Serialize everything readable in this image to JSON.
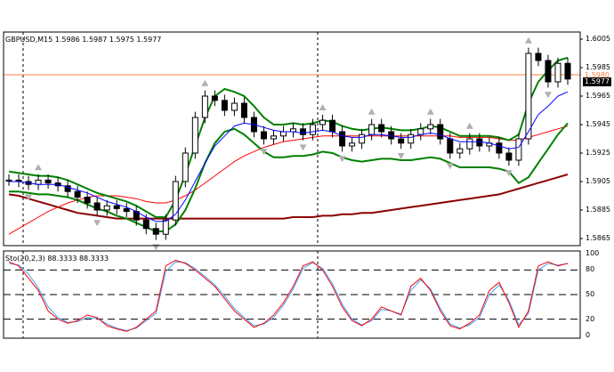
{
  "main_panel": {
    "title": "GBPUSD,M15  1.5986 1.5987 1.5975 1.5977",
    "price_labels": [
      "1.6005",
      "1.5985",
      "1.5965",
      "1.5945",
      "1.5925",
      "1.5905",
      "1.5885",
      "1.5865"
    ],
    "current_price": "1.5977",
    "upper_tag": "1.5980",
    "colors": {
      "ma_fast": "#0000ff",
      "ma_mid": "#ff0000",
      "ma_slow": "#8b0000",
      "envelope": "#008000",
      "candles": "#000000",
      "fractals": "#b0b0b0",
      "hline": "#ff8040",
      "price_tag_bg": "#000000"
    }
  },
  "sub_panel": {
    "title": "Sto(20,2,3) 88.3333 88.3333",
    "level_labels": [
      "100",
      "80",
      "50",
      "20",
      "0"
    ],
    "colors": {
      "main": "#ff0000",
      "signal": "#40a0ff"
    }
  },
  "chart_data": {
    "type": "line",
    "title": "GBPUSD,M15  1.5986 1.5987 1.5975 1.5977",
    "ylim": [
      1.586,
      1.601
    ],
    "y_ticks": [
      1.6005,
      1.5985,
      1.5965,
      1.5945,
      1.5925,
      1.5905,
      1.5885,
      1.5865
    ],
    "grid": false,
    "series": [
      {
        "values": [
          1.5906,
          1.5905,
          1.5903,
          1.5906,
          1.5904,
          1.5902,
          1.5898,
          1.5894,
          1.589,
          1.5885,
          1.5888,
          1.5886,
          1.5884,
          1.5878,
          1.5872,
          1.5868,
          1.5878,
          1.5905,
          1.5925,
          1.595,
          1.5965,
          1.5962,
          1.5955,
          1.596,
          1.595,
          1.594,
          1.5935,
          1.5937,
          1.594,
          1.5942,
          1.5938,
          1.5945,
          1.5948,
          1.594,
          1.593,
          1.5932,
          1.5938,
          1.5945,
          1.594,
          1.5935,
          1.5932,
          1.5938,
          1.5942,
          1.5945,
          1.5935,
          1.5925,
          1.5928,
          1.5935,
          1.593,
          1.5932,
          1.5925,
          1.592,
          1.5935,
          1.5995,
          1.599,
          1.5975,
          1.5988,
          1.5977
        ]
      },
      {
        "values": [
          1.5905,
          1.5905,
          1.5904,
          1.5903,
          1.5903,
          1.5903,
          1.5901,
          1.5899,
          1.5897,
          1.5894,
          1.5891,
          1.5889,
          1.5887,
          1.5884,
          1.588,
          1.5877,
          1.5877,
          1.5882,
          1.5892,
          1.5905,
          1.5918,
          1.593,
          1.5937,
          1.5944,
          1.5946,
          1.5945,
          1.5943,
          1.5941,
          1.594,
          1.594,
          1.5939,
          1.594,
          1.5941,
          1.594,
          1.5937,
          1.5936,
          1.5936,
          1.5938,
          1.5938,
          1.5937,
          1.5936,
          1.5936,
          1.5938,
          1.5939,
          1.5938,
          1.5935,
          1.5933,
          1.5933,
          1.5933,
          1.5932,
          1.593,
          1.5928,
          1.5929,
          1.594,
          1.5952,
          1.5958,
          1.5965,
          1.5968
        ]
      },
      {
        "values": [
          1.5868,
          1.5872,
          1.5876,
          1.588,
          1.5884,
          1.5887,
          1.589,
          1.5892,
          1.5894,
          1.5895,
          1.5895,
          1.5895,
          1.5894,
          1.5893,
          1.5891,
          1.589,
          1.589,
          1.5892,
          1.5895,
          1.5899,
          1.5904,
          1.5909,
          1.5914,
          1.5919,
          1.5923,
          1.5926,
          1.5929,
          1.5931,
          1.5933,
          1.5934,
          1.5935,
          1.5936,
          1.5937,
          1.5937,
          1.5937,
          1.5937,
          1.5937,
          1.5937,
          1.5937,
          1.5937,
          1.5937,
          1.5937,
          1.5937,
          1.5937,
          1.5937,
          1.5937,
          1.5936,
          1.5936,
          1.5936,
          1.5936,
          1.5935,
          1.5934,
          1.5934,
          1.5936,
          1.5938,
          1.594,
          1.5942,
          1.5944
        ]
      },
      {
        "values": [
          1.5896,
          1.5895,
          1.5893,
          1.5891,
          1.5889,
          1.5887,
          1.5885,
          1.5883,
          1.5882,
          1.5881,
          1.588,
          1.5879,
          1.5879,
          1.5879,
          1.5879,
          1.5879,
          1.5879,
          1.5879,
          1.5879,
          1.5879,
          1.5879,
          1.5879,
          1.5879,
          1.5879,
          1.5879,
          1.5879,
          1.5879,
          1.5879,
          1.5879,
          1.588,
          1.588,
          1.588,
          1.5881,
          1.5881,
          1.5882,
          1.5882,
          1.5883,
          1.5883,
          1.5884,
          1.5885,
          1.5886,
          1.5887,
          1.5888,
          1.5889,
          1.589,
          1.5891,
          1.5892,
          1.5893,
          1.5894,
          1.5895,
          1.5896,
          1.5898,
          1.59,
          1.5902,
          1.5904,
          1.5906,
          1.5908,
          1.591
        ]
      },
      {
        "values": [
          1.5912,
          1.5911,
          1.591,
          1.5909,
          1.5909,
          1.5908,
          1.5906,
          1.5903,
          1.59,
          1.5897,
          1.5895,
          1.5893,
          1.5891,
          1.5888,
          1.5884,
          1.588,
          1.588,
          1.5892,
          1.591,
          1.593,
          1.595,
          1.5965,
          1.597,
          1.5968,
          1.5965,
          1.5958,
          1.595,
          1.5945,
          1.5945,
          1.5946,
          1.5945,
          1.5946,
          1.5948,
          1.5947,
          1.5944,
          1.5942,
          1.5941,
          1.5942,
          1.5943,
          1.5942,
          1.5941,
          1.5941,
          1.5942,
          1.5944,
          1.5943,
          1.594,
          1.5937,
          1.5937,
          1.5937,
          1.5937,
          1.5936,
          1.5934,
          1.5938,
          1.596,
          1.5975,
          1.5983,
          1.599,
          1.5992
        ]
      },
      {
        "values": [
          1.5898,
          1.5898,
          1.5897,
          1.5896,
          1.5896,
          1.5895,
          1.5894,
          1.5892,
          1.5889,
          1.5886,
          1.5884,
          1.5881,
          1.5879,
          1.5876,
          1.5873,
          1.587,
          1.587,
          1.5875,
          1.5885,
          1.59,
          1.5918,
          1.5932,
          1.594,
          1.5942,
          1.5938,
          1.5932,
          1.5926,
          1.5922,
          1.5922,
          1.5923,
          1.5923,
          1.5924,
          1.5926,
          1.5925,
          1.5922,
          1.592,
          1.5919,
          1.592,
          1.5921,
          1.5921,
          1.592,
          1.592,
          1.5921,
          1.5922,
          1.5921,
          1.5918,
          1.5915,
          1.5915,
          1.5915,
          1.5915,
          1.5914,
          1.5912,
          1.5904,
          1.5908,
          1.5918,
          1.5928,
          1.5938,
          1.5946
        ]
      },
      {
        "values": [
          90,
          85,
          70,
          55,
          30,
          20,
          15,
          18,
          25,
          22,
          12,
          8,
          5,
          10,
          20,
          30,
          85,
          92,
          88,
          80,
          70,
          60,
          45,
          30,
          20,
          10,
          15,
          25,
          40,
          60,
          85,
          90,
          80,
          60,
          35,
          18,
          12,
          20,
          35,
          30,
          25,
          60,
          70,
          55,
          30,
          12,
          8,
          15,
          25,
          55,
          65,
          40,
          10,
          30,
          85,
          90,
          85,
          88
        ]
      },
      {
        "values": [
          88,
          86,
          75,
          58,
          35,
          22,
          16,
          17,
          22,
          21,
          14,
          9,
          6,
          9,
          18,
          27,
          78,
          90,
          89,
          82,
          72,
          62,
          48,
          33,
          22,
          12,
          14,
          22,
          37,
          57,
          82,
          89,
          82,
          63,
          38,
          20,
          13,
          18,
          32,
          30,
          26,
          55,
          68,
          57,
          33,
          14,
          9,
          13,
          22,
          50,
          62,
          43,
          13,
          27,
          80,
          88,
          86,
          88
        ]
      }
    ]
  }
}
